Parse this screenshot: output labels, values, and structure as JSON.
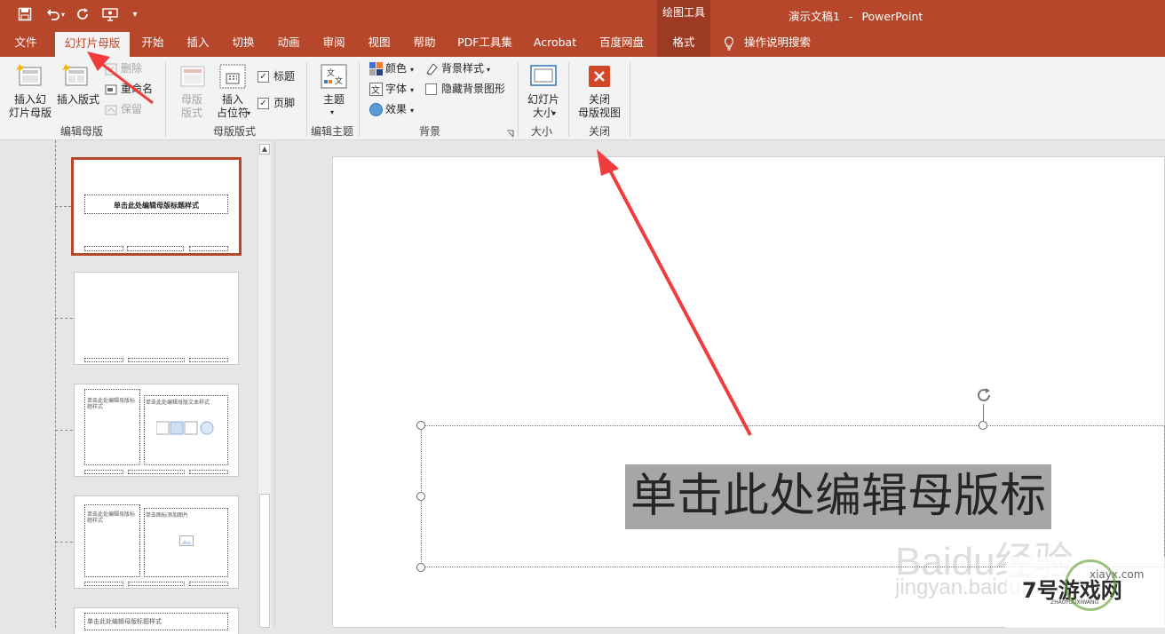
{
  "window": {
    "document_title": "演示文稿1",
    "separator": "-",
    "app_name": "PowerPoint",
    "context_tools_header": "绘图工具"
  },
  "colors": {
    "accent": "#b7472a",
    "context_tab": "#9c3b22",
    "ribbon_bg": "#f3f3f3",
    "annotation_arrow": "#f03c3c"
  },
  "qat": [
    "save-icon",
    "undo-icon",
    "redo-icon",
    "present-icon",
    "customize-icon"
  ],
  "tabs": {
    "file": "文件",
    "slide_master": "幻灯片母版",
    "home": "开始",
    "insert": "插入",
    "transitions": "切换",
    "animations": "动画",
    "review": "审阅",
    "view": "视图",
    "help": "帮助",
    "pdf_tools": "PDF工具集",
    "acrobat": "Acrobat",
    "baidu_netdisk": "百度网盘",
    "format": "格式",
    "tell_me": "操作说明搜索"
  },
  "ribbon": {
    "edit_master": {
      "label": "编辑母版",
      "insert_slide_master": "插入幻\n灯片母版",
      "insert_layout": "插入版式",
      "delete": "删除",
      "rename": "重命名",
      "preserve": "保留"
    },
    "master_layout": {
      "label": "母版版式",
      "master_layout_btn": "母版\n版式",
      "insert_placeholder": "插入\n占位符",
      "title_check": "标题",
      "footer_check": "页脚"
    },
    "edit_theme": {
      "label": "编辑主题",
      "themes": "主题"
    },
    "background": {
      "label": "背景",
      "colors": "颜色",
      "fonts": "字体",
      "effects": "效果",
      "background_styles": "背景样式",
      "hide_bg_graphics": "隐藏背景图形"
    },
    "size": {
      "label": "大小",
      "slide_size": "幻灯片\n大小"
    },
    "close": {
      "label": "关闭",
      "close_master_view": "关闭\n母版视图"
    }
  },
  "thumbnails": {
    "master_title": "单击此处编辑母版标题样式",
    "layout3_title": "单击此处编辑母版标题样式",
    "layout3_body": "单击此处编辑母版文本样式",
    "layout4_title": "单击此处编辑母版标题样式",
    "layout4_pic": "单击图标添加图片",
    "layout5_title": "单击此处编辑母版标题样式"
  },
  "slide": {
    "title_text": "单击此处编辑母版标"
  },
  "watermarks": {
    "baidu": "Baidu经验",
    "jingyan": "jingyan.baidu.com",
    "site": "xiayx.com",
    "game": "7号游戏网",
    "game_sub": "ZHAOYOUXIWANG"
  }
}
